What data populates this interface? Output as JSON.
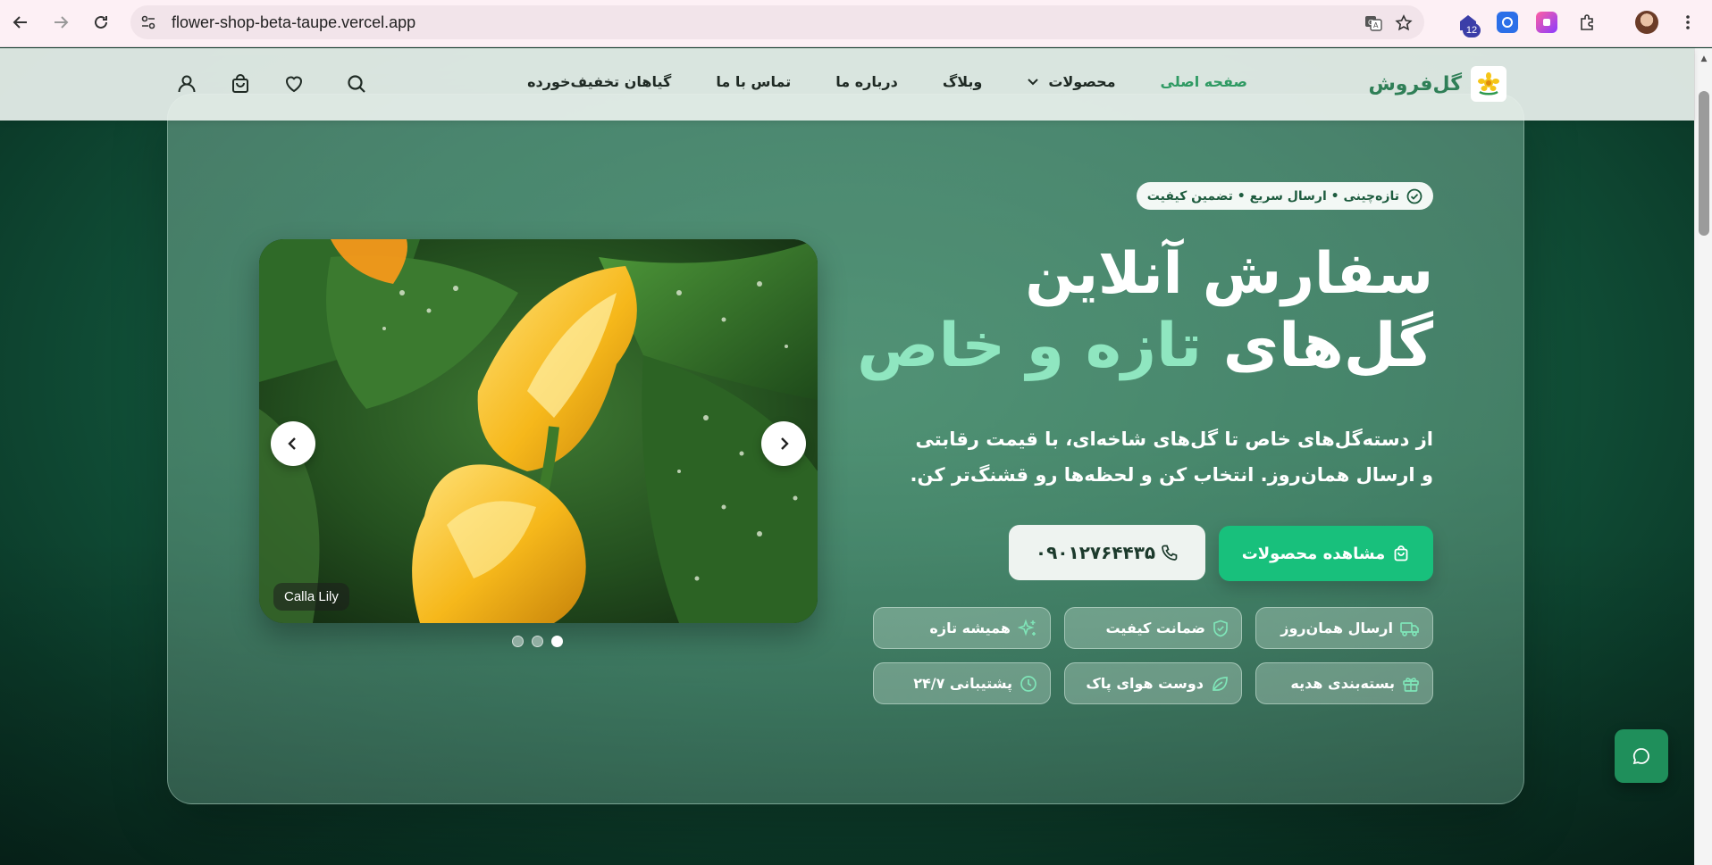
{
  "browser": {
    "url": "flower-shop-beta-taupe.vercel.app",
    "extension_badge": "12"
  },
  "header": {
    "brand": "گل‌فروش",
    "nav": {
      "home": "صفحه اصلی",
      "products": "محصولات",
      "blog": "وبلاگ",
      "about": "درباره ما",
      "contact": "تماس با ما",
      "discount_plants": "گیاهان تخفیف‌خورده"
    }
  },
  "hero": {
    "tagline": "تازه‌چینی • ارسال سریع • تضمین کیفیت",
    "title_line1": "سفارش آنلاین",
    "title_line2_prefix": "گل‌های ",
    "title_line2_accent": "تازه و خاص",
    "description": "از دسته‌گل‌های خاص تا گل‌های شاخه‌ای، با قیمت رقابتی و ارسال همان‌روز. انتخاب کن و لحظه‌ها رو قشنگ‌تر کن.",
    "cta_primary": "مشاهده محصولات",
    "cta_phone": "۰۹۰۱۲۷۶۴۴۳۵",
    "features": [
      {
        "label": "ارسال همان‌روز",
        "icon": "truck-icon"
      },
      {
        "label": "ضمانت کیفیت",
        "icon": "shield-icon"
      },
      {
        "label": "همیشه تازه",
        "icon": "sparkles-icon"
      },
      {
        "label": "بسته‌بندی هدیه",
        "icon": "gift-icon"
      },
      {
        "label": "دوست هوای پاک",
        "icon": "leaf-icon"
      },
      {
        "label": "پشتیبانی ۲۴/۷",
        "icon": "clock-icon"
      }
    ]
  },
  "slider": {
    "caption": "Calla Lily",
    "slide_count": 3,
    "active_index": 2
  },
  "colors": {
    "accent": "#18c07c",
    "brand": "#2f7f57",
    "title_accent": "#8fe6c0"
  }
}
